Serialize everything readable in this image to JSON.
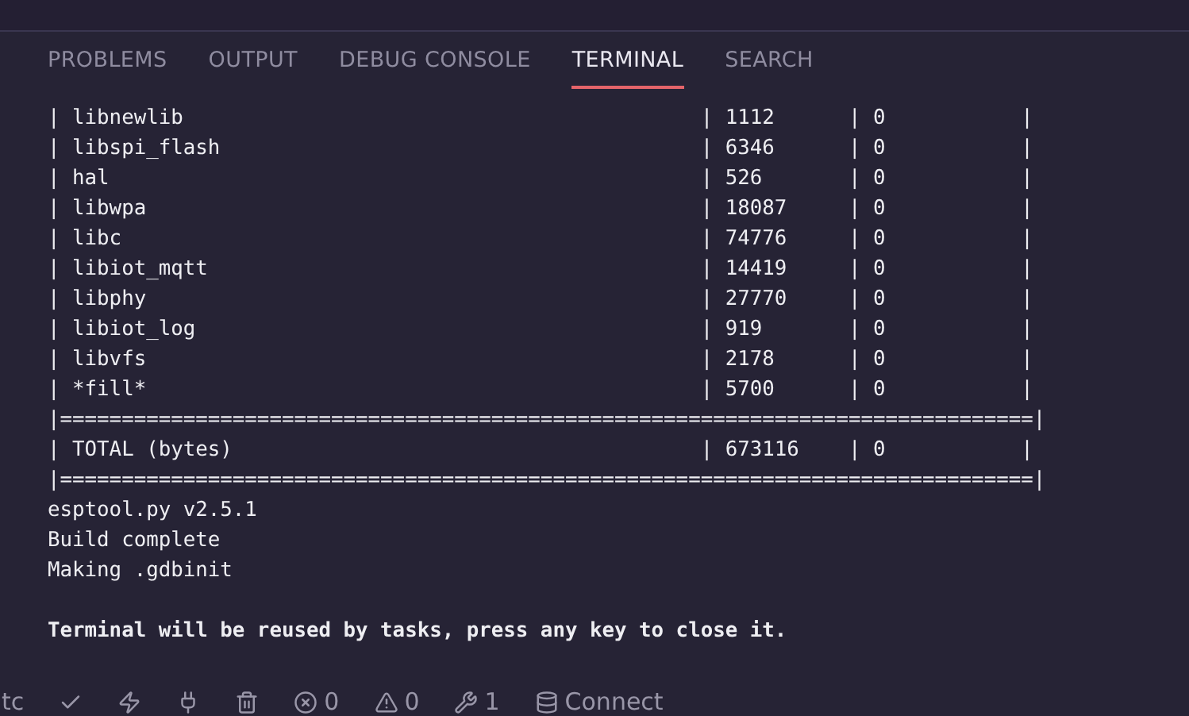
{
  "tabs": [
    {
      "label": "PROBLEMS",
      "selected": false
    },
    {
      "label": "OUTPUT",
      "selected": false
    },
    {
      "label": "DEBUG CONSOLE",
      "selected": false
    },
    {
      "label": "TERMINAL",
      "selected": true
    },
    {
      "label": "SEARCH",
      "selected": false
    }
  ],
  "terminal": {
    "lines": [
      {
        "kind": "output",
        "text": "| libnewlib                                          | 1112      | 0           |"
      },
      {
        "kind": "output",
        "text": "| libspi_flash                                       | 6346      | 0           |"
      },
      {
        "kind": "output",
        "text": "| hal                                                | 526       | 0           |"
      },
      {
        "kind": "output",
        "text": "| libwpa                                             | 18087     | 0           |"
      },
      {
        "kind": "output",
        "text": "| libc                                               | 74776     | 0           |"
      },
      {
        "kind": "output",
        "text": "| libiot_mqtt                                        | 14419     | 0           |"
      },
      {
        "kind": "output",
        "text": "| libphy                                             | 27770     | 0           |"
      },
      {
        "kind": "output",
        "text": "| libiot_log                                         | 919       | 0           |"
      },
      {
        "kind": "output",
        "text": "| libvfs                                             | 2178      | 0           |"
      },
      {
        "kind": "output",
        "text": "| *fill*                                             | 5700      | 0           |"
      },
      {
        "kind": "output",
        "text": "|===============================================================================|"
      },
      {
        "kind": "output",
        "text": "| TOTAL (bytes)                                      | 673116    | 0           |"
      },
      {
        "kind": "output",
        "text": "|===============================================================================|"
      },
      {
        "kind": "output",
        "text": "esptool.py v2.5.1"
      },
      {
        "kind": "output",
        "text": "Build complete"
      },
      {
        "kind": "output",
        "text": "Making .gdbinit"
      },
      {
        "kind": "notice",
        "text": "Terminal will be reused by tasks, press any key to close it."
      }
    ]
  },
  "status_bar": {
    "items": [
      {
        "kind": "text",
        "text": "tc"
      },
      {
        "kind": "check"
      },
      {
        "kind": "bolt"
      },
      {
        "kind": "plug"
      },
      {
        "kind": "trash"
      },
      {
        "kind": "errors",
        "text": "0"
      },
      {
        "kind": "warnings",
        "text": "0"
      },
      {
        "kind": "tools",
        "text": "1"
      },
      {
        "kind": "database",
        "text": "Connect"
      }
    ]
  }
}
